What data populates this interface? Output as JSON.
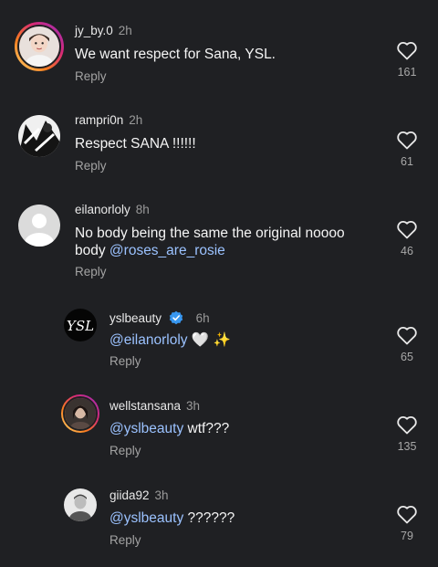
{
  "comments": [
    {
      "username": "jy_by.0",
      "time": "2h",
      "text": "We want respect for Sana, YSL.",
      "reply": "Reply",
      "likes": "161",
      "avatar": "photo-avatar-with-story-ring"
    },
    {
      "username": "rampri0n",
      "time": "2h",
      "text": "Respect SANA !!!!!!",
      "reply": "Reply",
      "likes": "61",
      "avatar": "photo-avatar-bw"
    },
    {
      "username": "eilanorloly",
      "time": "8h",
      "text_line1": "No body being the same the original noooo",
      "text_line2_prefix": "body ",
      "mention": "@roses_are_rosie",
      "reply": "Reply",
      "likes": "46",
      "avatar": "default-avatar"
    },
    {
      "username": "yslbeauty",
      "time": "6h",
      "verified": true,
      "mention": "@eilanorloly",
      "emoji": "🤍 ✨",
      "reply": "Reply",
      "likes": "65",
      "avatar": "ysl-logo-avatar"
    },
    {
      "username": "wellstansana",
      "time": "3h",
      "mention": "@yslbeauty",
      "text_suffix": " wtf???",
      "reply": "Reply",
      "likes": "135",
      "avatar": "photo-avatar-with-story-ring"
    },
    {
      "username": "giida92",
      "time": "3h",
      "mention": "@yslbeauty",
      "text_suffix": " ??????",
      "reply": "Reply",
      "likes": "79",
      "avatar": "photo-avatar-bw"
    }
  ],
  "icons": {
    "like": "heart-outline-icon",
    "verified": "verified-badge-icon"
  },
  "colors": {
    "background": "#1f2023",
    "mention": "#9bc2ff",
    "story_ring": "#e1306c",
    "verified": "#3897f0"
  }
}
